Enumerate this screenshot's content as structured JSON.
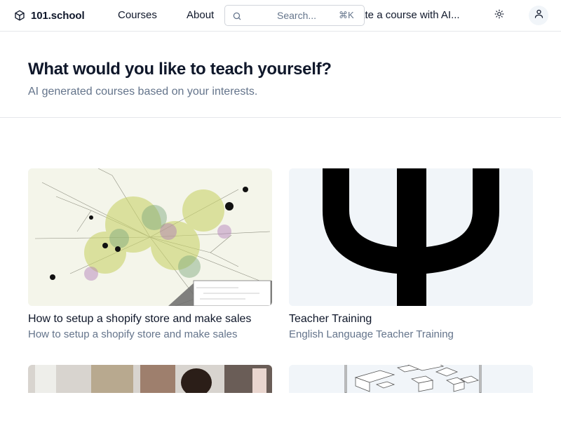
{
  "header": {
    "brand": "101.school",
    "nav": {
      "courses": "Courses",
      "about": "About",
      "create": "Create a course with AI..."
    },
    "search": {
      "placeholder": "Search...",
      "shortcut": "⌘K"
    },
    "icons": {
      "logo": "cube-icon",
      "search": "search-icon",
      "theme": "sun-icon",
      "user": "user-icon"
    }
  },
  "hero": {
    "title": "What would you like to teach yourself?",
    "subtitle": "AI generated courses based on your interests."
  },
  "courses": [
    {
      "title": "How to setup a shopify store and make sales",
      "description": "How to setup a shopify store and make sales",
      "image": "network-graph"
    },
    {
      "title": "Teacher Training",
      "description": "English Language Teacher Training",
      "image": "psi-symbol"
    },
    {
      "title": "",
      "description": "",
      "image": "people-photo"
    },
    {
      "title": "",
      "description": "",
      "image": "cubes-sketch"
    }
  ],
  "colors": {
    "text": "#0f172a",
    "muted": "#64748b",
    "border": "#e5e7eb",
    "card_bg": "#f1f5f9"
  }
}
